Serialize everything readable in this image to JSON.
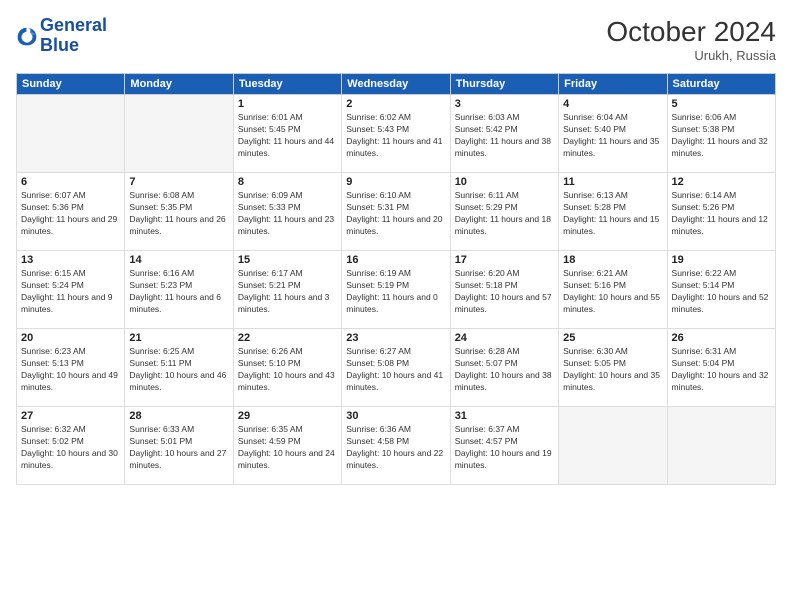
{
  "logo": {
    "line1": "General",
    "line2": "Blue"
  },
  "title": "October 2024",
  "location": "Urukh, Russia",
  "weekdays": [
    "Sunday",
    "Monday",
    "Tuesday",
    "Wednesday",
    "Thursday",
    "Friday",
    "Saturday"
  ],
  "weeks": [
    [
      {
        "day": "",
        "sunrise": "",
        "sunset": "",
        "daylight": ""
      },
      {
        "day": "",
        "sunrise": "",
        "sunset": "",
        "daylight": ""
      },
      {
        "day": "1",
        "sunrise": "Sunrise: 6:01 AM",
        "sunset": "Sunset: 5:45 PM",
        "daylight": "Daylight: 11 hours and 44 minutes."
      },
      {
        "day": "2",
        "sunrise": "Sunrise: 6:02 AM",
        "sunset": "Sunset: 5:43 PM",
        "daylight": "Daylight: 11 hours and 41 minutes."
      },
      {
        "day": "3",
        "sunrise": "Sunrise: 6:03 AM",
        "sunset": "Sunset: 5:42 PM",
        "daylight": "Daylight: 11 hours and 38 minutes."
      },
      {
        "day": "4",
        "sunrise": "Sunrise: 6:04 AM",
        "sunset": "Sunset: 5:40 PM",
        "daylight": "Daylight: 11 hours and 35 minutes."
      },
      {
        "day": "5",
        "sunrise": "Sunrise: 6:06 AM",
        "sunset": "Sunset: 5:38 PM",
        "daylight": "Daylight: 11 hours and 32 minutes."
      }
    ],
    [
      {
        "day": "6",
        "sunrise": "Sunrise: 6:07 AM",
        "sunset": "Sunset: 5:36 PM",
        "daylight": "Daylight: 11 hours and 29 minutes."
      },
      {
        "day": "7",
        "sunrise": "Sunrise: 6:08 AM",
        "sunset": "Sunset: 5:35 PM",
        "daylight": "Daylight: 11 hours and 26 minutes."
      },
      {
        "day": "8",
        "sunrise": "Sunrise: 6:09 AM",
        "sunset": "Sunset: 5:33 PM",
        "daylight": "Daylight: 11 hours and 23 minutes."
      },
      {
        "day": "9",
        "sunrise": "Sunrise: 6:10 AM",
        "sunset": "Sunset: 5:31 PM",
        "daylight": "Daylight: 11 hours and 20 minutes."
      },
      {
        "day": "10",
        "sunrise": "Sunrise: 6:11 AM",
        "sunset": "Sunset: 5:29 PM",
        "daylight": "Daylight: 11 hours and 18 minutes."
      },
      {
        "day": "11",
        "sunrise": "Sunrise: 6:13 AM",
        "sunset": "Sunset: 5:28 PM",
        "daylight": "Daylight: 11 hours and 15 minutes."
      },
      {
        "day": "12",
        "sunrise": "Sunrise: 6:14 AM",
        "sunset": "Sunset: 5:26 PM",
        "daylight": "Daylight: 11 hours and 12 minutes."
      }
    ],
    [
      {
        "day": "13",
        "sunrise": "Sunrise: 6:15 AM",
        "sunset": "Sunset: 5:24 PM",
        "daylight": "Daylight: 11 hours and 9 minutes."
      },
      {
        "day": "14",
        "sunrise": "Sunrise: 6:16 AM",
        "sunset": "Sunset: 5:23 PM",
        "daylight": "Daylight: 11 hours and 6 minutes."
      },
      {
        "day": "15",
        "sunrise": "Sunrise: 6:17 AM",
        "sunset": "Sunset: 5:21 PM",
        "daylight": "Daylight: 11 hours and 3 minutes."
      },
      {
        "day": "16",
        "sunrise": "Sunrise: 6:19 AM",
        "sunset": "Sunset: 5:19 PM",
        "daylight": "Daylight: 11 hours and 0 minutes."
      },
      {
        "day": "17",
        "sunrise": "Sunrise: 6:20 AM",
        "sunset": "Sunset: 5:18 PM",
        "daylight": "Daylight: 10 hours and 57 minutes."
      },
      {
        "day": "18",
        "sunrise": "Sunrise: 6:21 AM",
        "sunset": "Sunset: 5:16 PM",
        "daylight": "Daylight: 10 hours and 55 minutes."
      },
      {
        "day": "19",
        "sunrise": "Sunrise: 6:22 AM",
        "sunset": "Sunset: 5:14 PM",
        "daylight": "Daylight: 10 hours and 52 minutes."
      }
    ],
    [
      {
        "day": "20",
        "sunrise": "Sunrise: 6:23 AM",
        "sunset": "Sunset: 5:13 PM",
        "daylight": "Daylight: 10 hours and 49 minutes."
      },
      {
        "day": "21",
        "sunrise": "Sunrise: 6:25 AM",
        "sunset": "Sunset: 5:11 PM",
        "daylight": "Daylight: 10 hours and 46 minutes."
      },
      {
        "day": "22",
        "sunrise": "Sunrise: 6:26 AM",
        "sunset": "Sunset: 5:10 PM",
        "daylight": "Daylight: 10 hours and 43 minutes."
      },
      {
        "day": "23",
        "sunrise": "Sunrise: 6:27 AM",
        "sunset": "Sunset: 5:08 PM",
        "daylight": "Daylight: 10 hours and 41 minutes."
      },
      {
        "day": "24",
        "sunrise": "Sunrise: 6:28 AM",
        "sunset": "Sunset: 5:07 PM",
        "daylight": "Daylight: 10 hours and 38 minutes."
      },
      {
        "day": "25",
        "sunrise": "Sunrise: 6:30 AM",
        "sunset": "Sunset: 5:05 PM",
        "daylight": "Daylight: 10 hours and 35 minutes."
      },
      {
        "day": "26",
        "sunrise": "Sunrise: 6:31 AM",
        "sunset": "Sunset: 5:04 PM",
        "daylight": "Daylight: 10 hours and 32 minutes."
      }
    ],
    [
      {
        "day": "27",
        "sunrise": "Sunrise: 6:32 AM",
        "sunset": "Sunset: 5:02 PM",
        "daylight": "Daylight: 10 hours and 30 minutes."
      },
      {
        "day": "28",
        "sunrise": "Sunrise: 6:33 AM",
        "sunset": "Sunset: 5:01 PM",
        "daylight": "Daylight: 10 hours and 27 minutes."
      },
      {
        "day": "29",
        "sunrise": "Sunrise: 6:35 AM",
        "sunset": "Sunset: 4:59 PM",
        "daylight": "Daylight: 10 hours and 24 minutes."
      },
      {
        "day": "30",
        "sunrise": "Sunrise: 6:36 AM",
        "sunset": "Sunset: 4:58 PM",
        "daylight": "Daylight: 10 hours and 22 minutes."
      },
      {
        "day": "31",
        "sunrise": "Sunrise: 6:37 AM",
        "sunset": "Sunset: 4:57 PM",
        "daylight": "Daylight: 10 hours and 19 minutes."
      },
      {
        "day": "",
        "sunrise": "",
        "sunset": "",
        "daylight": ""
      },
      {
        "day": "",
        "sunrise": "",
        "sunset": "",
        "daylight": ""
      }
    ]
  ]
}
